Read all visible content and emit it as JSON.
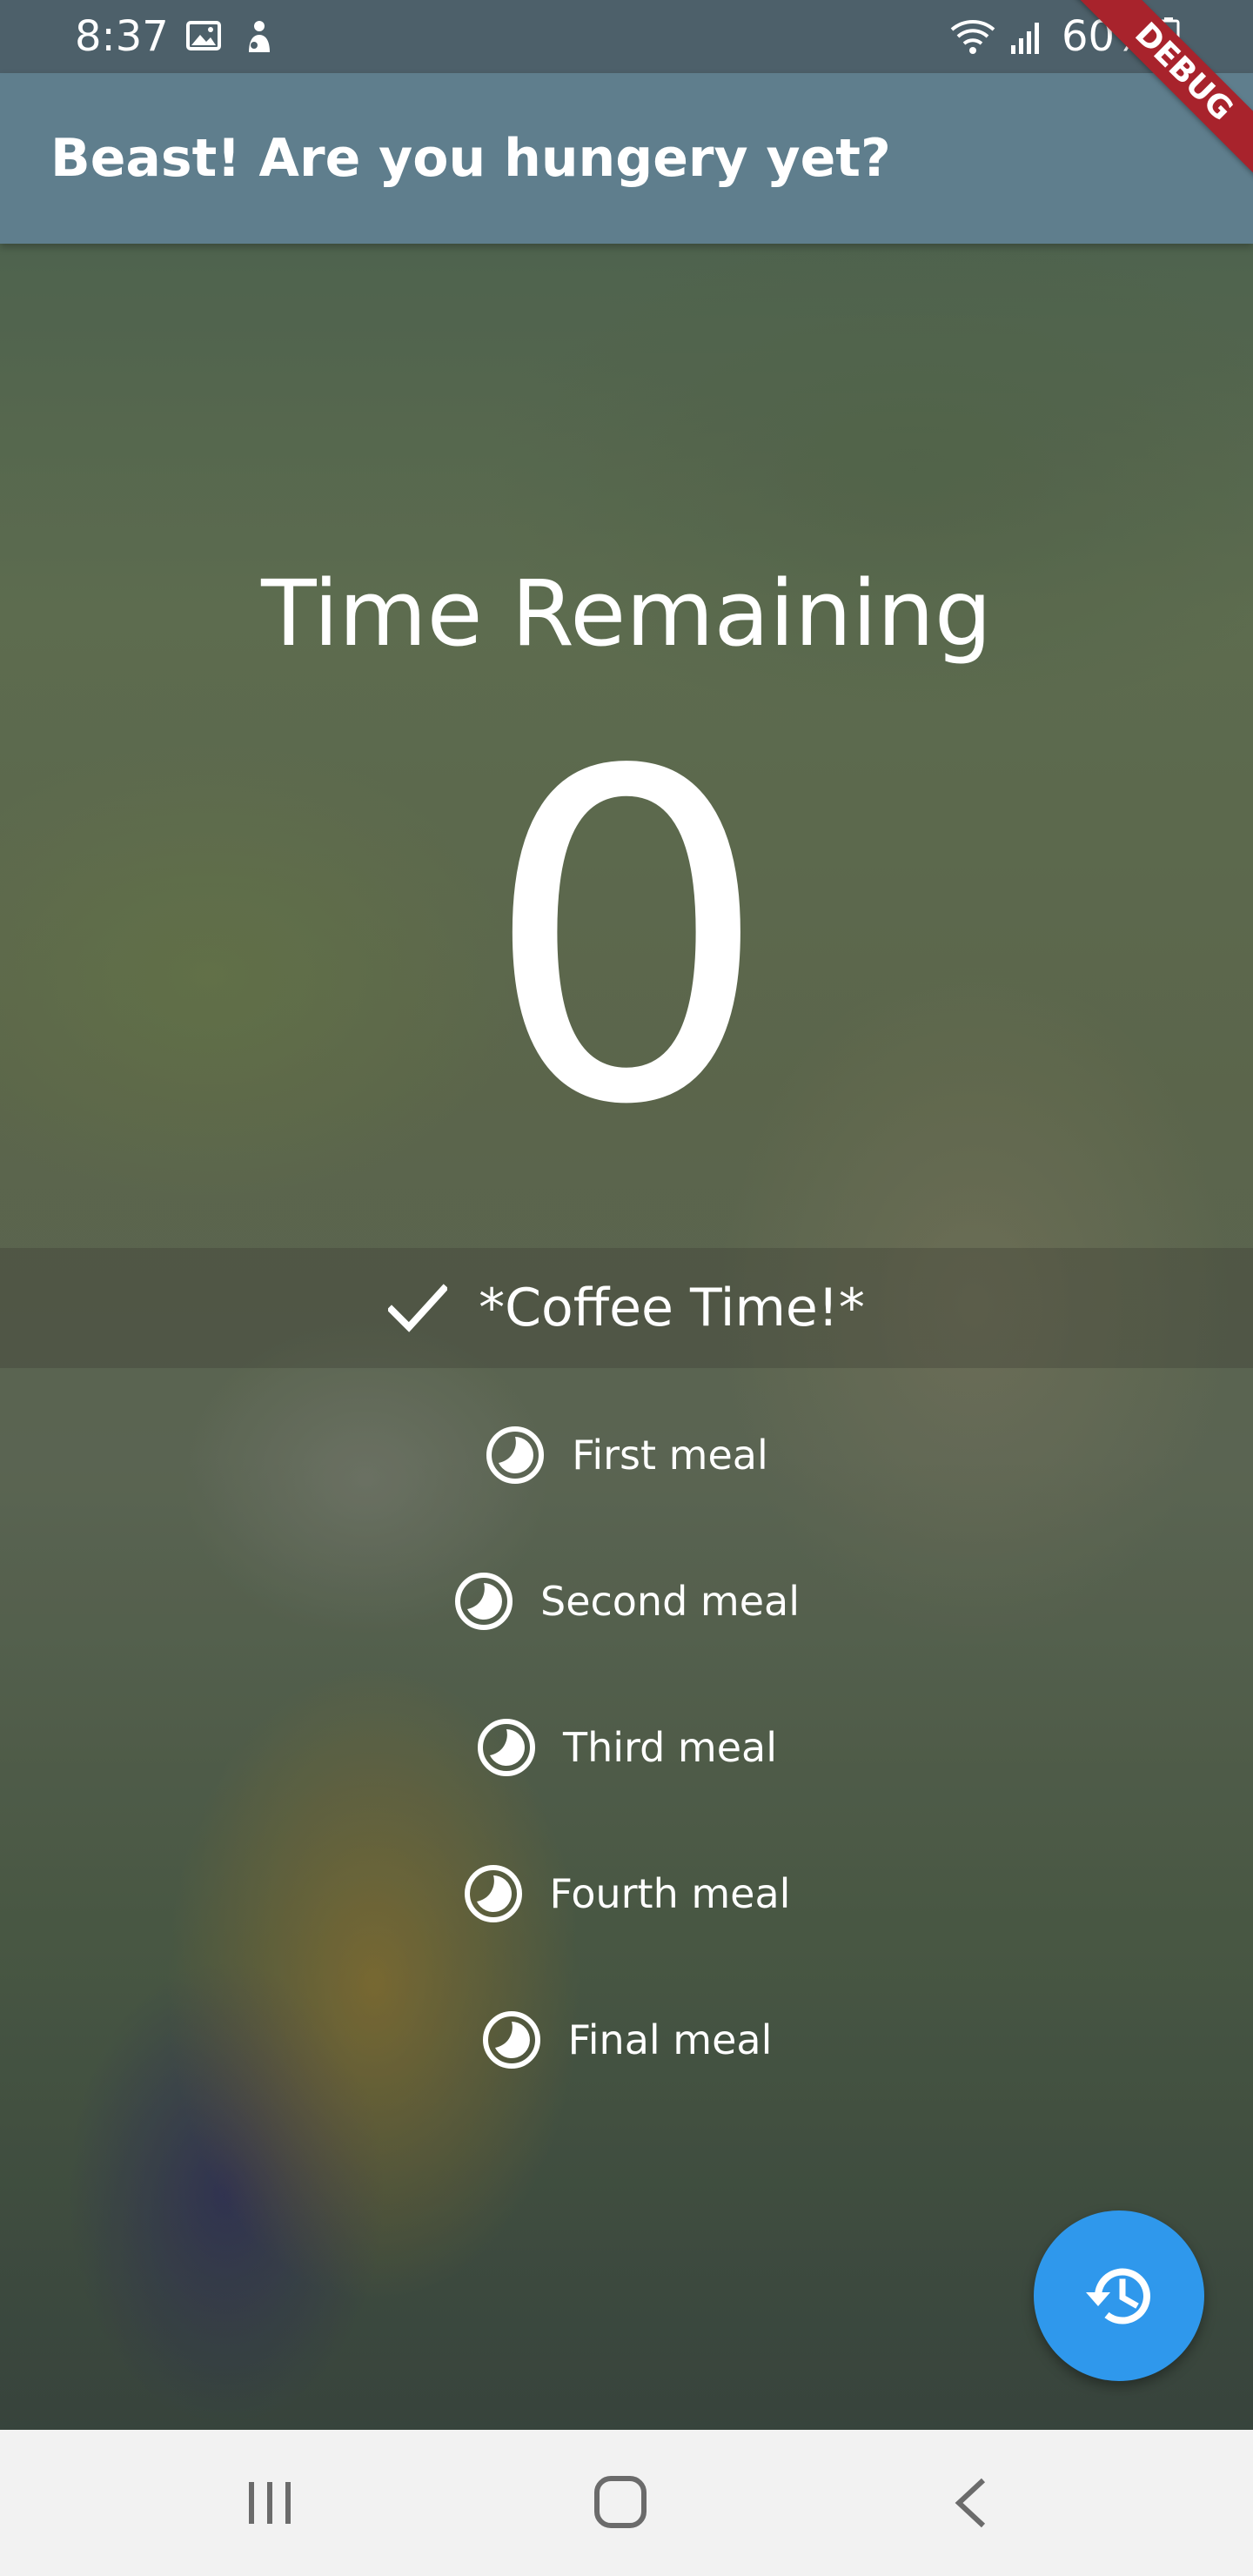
{
  "status_bar": {
    "time": "8:37",
    "battery": "60%",
    "icons": [
      "photo-icon",
      "person-icon",
      "wifi-icon",
      "signal-icon",
      "battery-icon"
    ]
  },
  "app_bar": {
    "title": "Beast! Are you hungery yet?",
    "debug_banner": "DEBUG"
  },
  "main": {
    "heading": "Time Remaining",
    "countdown": "0",
    "current_meal": {
      "label": "*Coffee Time!*",
      "icon": "check-icon"
    },
    "meals": [
      {
        "label": "First meal",
        "icon": "clock-icon"
      },
      {
        "label": "Second meal",
        "icon": "clock-icon"
      },
      {
        "label": "Third meal",
        "icon": "clock-icon"
      },
      {
        "label": "Fourth meal",
        "icon": "clock-icon"
      },
      {
        "label": "Final meal",
        "icon": "clock-icon"
      }
    ]
  },
  "fab": {
    "icon": "history-icon",
    "color": "#2f98ec"
  },
  "nav_bar": {
    "buttons": [
      "recents-icon",
      "home-icon",
      "back-icon"
    ]
  },
  "colors": {
    "app_bar": "#5f7e8d",
    "status_bar": "#4d606a",
    "debug_ribbon": "#a8232c",
    "nav_bar": "#f2f2f2"
  }
}
